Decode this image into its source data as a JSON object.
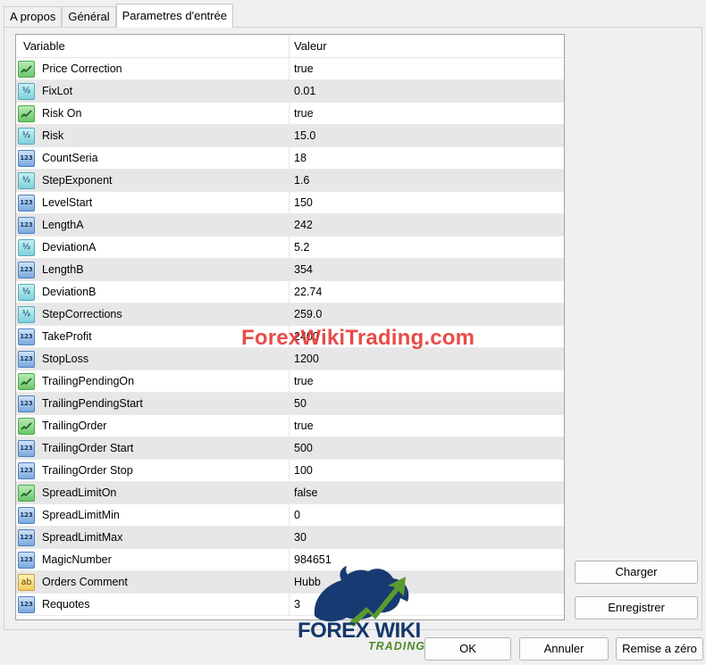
{
  "tabs": [
    "A propos",
    "Général",
    "Parametres d'entrée"
  ],
  "grid": {
    "headers": {
      "variable": "Variable",
      "value": "Valeur"
    },
    "rows": [
      {
        "type": "bool-icon",
        "name": "Price Correction",
        "value": "true"
      },
      {
        "type": "double-icon",
        "name": "FixLot",
        "value": "0.01"
      },
      {
        "type": "bool-icon",
        "name": "Risk On",
        "value": "true"
      },
      {
        "type": "double-icon",
        "name": "Risk",
        "value": "15.0"
      },
      {
        "type": "int-icon",
        "name": "CountSeria",
        "value": "18"
      },
      {
        "type": "double-icon",
        "name": "StepExponent",
        "value": "1.6"
      },
      {
        "type": "int-icon",
        "name": "LevelStart",
        "value": "150"
      },
      {
        "type": "int-icon",
        "name": "LengthA",
        "value": "242"
      },
      {
        "type": "double-icon",
        "name": "DeviationA",
        "value": "5.2"
      },
      {
        "type": "int-icon",
        "name": "LengthB",
        "value": "354"
      },
      {
        "type": "double-icon",
        "name": "DeviationB",
        "value": "22.74"
      },
      {
        "type": "double-icon",
        "name": "StepCorrections",
        "value": "259.0"
      },
      {
        "type": "int-icon",
        "name": "TakeProfit",
        "value": "2400"
      },
      {
        "type": "int-icon",
        "name": "StopLoss",
        "value": "1200"
      },
      {
        "type": "bool-icon",
        "name": "TrailingPendingOn",
        "value": "true"
      },
      {
        "type": "int-icon",
        "name": "TrailingPendingStart",
        "value": "50"
      },
      {
        "type": "bool-icon",
        "name": "TrailingOrder",
        "value": "true"
      },
      {
        "type": "int-icon",
        "name": "TrailingOrder Start",
        "value": "500"
      },
      {
        "type": "int-icon",
        "name": "TrailingOrder Stop",
        "value": "100"
      },
      {
        "type": "bool-icon",
        "name": "SpreadLimitOn",
        "value": "false"
      },
      {
        "type": "int-icon",
        "name": "SpreadLimitMin",
        "value": "0"
      },
      {
        "type": "int-icon",
        "name": "SpreadLimitMax",
        "value": "30"
      },
      {
        "type": "int-icon",
        "name": "MagicNumber",
        "value": "984651"
      },
      {
        "type": "string-icon",
        "name": "Orders Comment",
        "value": "Hubb"
      },
      {
        "type": "int-icon",
        "name": "Requotes",
        "value": "3"
      }
    ]
  },
  "icon_glyphs": {
    "double": "½",
    "int": "123",
    "string": "ab"
  },
  "buttons": {
    "charger": "Charger",
    "enregistrer": "Enregistrer",
    "ok": "OK",
    "annuler": "Annuler",
    "remise": "Remise a zéro"
  },
  "watermark": {
    "text": "ForexWikiTrading.com",
    "logo_line1": "FOREX WIKI",
    "logo_line2": "TRADING"
  },
  "colors": {
    "bool": "#6cc56a",
    "double": "#7fd0dc",
    "int": "#7aa9de",
    "string": "#f1cb5c",
    "watermark": "#e53935"
  }
}
